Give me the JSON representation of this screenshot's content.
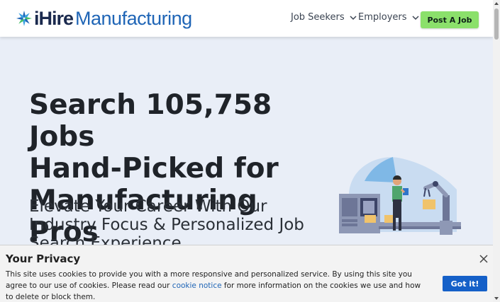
{
  "header": {
    "logo": {
      "brand_prefix": "iHire",
      "brand_suffix": "Manufacturing"
    },
    "nav": [
      {
        "label": "Job Seekers",
        "icon": "chevron-down-icon"
      },
      {
        "label": "Employers",
        "icon": "chevron-down-icon"
      }
    ],
    "post_job_label": "Post A Job"
  },
  "hero": {
    "title_line1": "Search 105,758 Jobs",
    "title_line2": "Hand-Picked for",
    "title_line3": "Manufacturing Pros",
    "subtitle": "Elevate Your Career With Our Industry Focus & Personalized Job Search Experience"
  },
  "privacy": {
    "title": "Your Privacy",
    "text_before_link": "This site uses cookies to provide you with a more responsive and personalized service. By using this site you agree to our use of cookies. Please read our ",
    "link_text": "cookie notice",
    "text_after_link": " for more information on the cookies we use and how to delete or block them.",
    "button_label": "Got it!"
  },
  "colors": {
    "accent_green": "#8be06b",
    "brand_blue": "#1f65b6",
    "brand_navy": "#1b2a4e",
    "button_blue": "#1560c8",
    "hero_bg": "#e9eef7"
  }
}
